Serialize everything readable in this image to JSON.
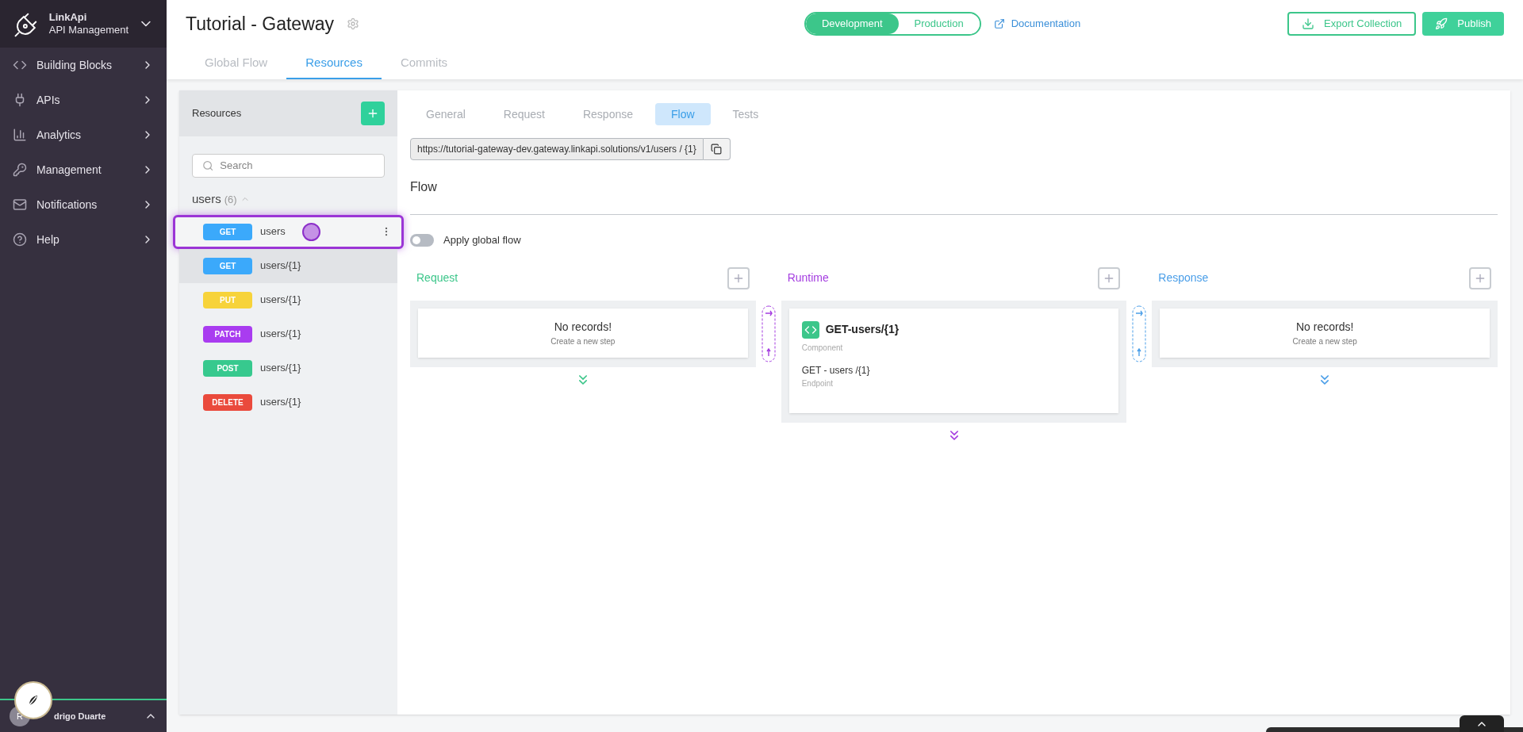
{
  "brand": {
    "name": "LinkApi",
    "subtitle": "API Management"
  },
  "nav": [
    {
      "label": "Building Blocks",
      "kind": "code"
    },
    {
      "label": "APIs",
      "kind": "plug"
    },
    {
      "label": "Analytics",
      "kind": "chart"
    },
    {
      "label": "Management",
      "kind": "key"
    },
    {
      "label": "Notifications",
      "kind": "mail"
    },
    {
      "label": "Help",
      "kind": "help"
    }
  ],
  "user": {
    "initial": "R",
    "name": "drigo Duarte"
  },
  "header": {
    "title": "Tutorial - Gateway",
    "environments": [
      {
        "label": "Development",
        "selected": true
      },
      {
        "label": "Production",
        "selected": false
      }
    ],
    "docs_link": "Documentation",
    "actions": [
      {
        "label": "Export Collection",
        "kind": "outline"
      },
      {
        "label": "Publish",
        "kind": "solid"
      }
    ]
  },
  "tabs": [
    {
      "label": "Global Flow",
      "selected": false
    },
    {
      "label": "Resources",
      "selected": true
    },
    {
      "label": "Commits",
      "selected": false
    }
  ],
  "resources": {
    "title": "Resources",
    "search": {
      "placeholder": "Search"
    },
    "group": {
      "name": "users",
      "count": "(6)",
      "expanded": true
    },
    "items": [
      {
        "method": "GET",
        "color": "#3ba9fb",
        "path": "users",
        "selected": false,
        "highlighted": true
      },
      {
        "method": "GET",
        "color": "#3ba9fb",
        "path": "users/{1}",
        "selected": true,
        "highlighted": false
      },
      {
        "method": "PUT",
        "color": "#f7d33a",
        "path": "users/{1}",
        "selected": false,
        "highlighted": false
      },
      {
        "method": "PATCH",
        "color": "#a93cf0",
        "path": "users/{1}",
        "selected": false,
        "highlighted": false
      },
      {
        "method": "POST",
        "color": "#37c98e",
        "path": "users/{1}",
        "selected": false,
        "highlighted": false
      },
      {
        "method": "DELETE",
        "color": "#ea4a3c",
        "path": "users/{1}",
        "selected": false,
        "highlighted": false
      }
    ]
  },
  "detail": {
    "tabs": [
      {
        "label": "General",
        "selected": false
      },
      {
        "label": "Request",
        "selected": false
      },
      {
        "label": "Response",
        "selected": false
      },
      {
        "label": "Flow",
        "selected": true
      },
      {
        "label": "Tests",
        "selected": false
      }
    ],
    "url": "https://tutorial-gateway-dev.gateway.linkapi.solutions/v1/users / {1}",
    "section_title": "Flow",
    "apply_global_flow": {
      "label": "Apply global flow",
      "on": false
    },
    "stages": [
      {
        "title": "Request",
        "color": "#3cc68a",
        "empty_title": "No records!",
        "empty_hint": "Create a new step"
      },
      {
        "title": "Runtime",
        "color": "#a43ce0",
        "steps": [
          {
            "name": "GET-users/{1}",
            "type": "Component",
            "endpoint": "GET - users /{1}",
            "endpoint_label": "Endpoint"
          }
        ]
      },
      {
        "title": "Response",
        "color": "#4a9ee8",
        "empty_title": "No records!",
        "empty_hint": "Create a new step"
      }
    ]
  }
}
